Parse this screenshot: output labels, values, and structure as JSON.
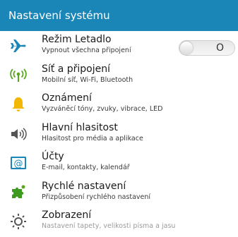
{
  "header": {
    "title": "Nastavení systému"
  },
  "items": [
    {
      "title": "Režim Letadlo",
      "subtitle": "Vypnout všechna připojení",
      "icon": "airplane-icon",
      "toggle": {
        "state": "O",
        "on": false
      }
    },
    {
      "title": "Síť a připojení",
      "subtitle": "Mobilní síť, Wi-Fi, Bluetooth",
      "icon": "antenna-icon"
    },
    {
      "title": "Oznámení",
      "subtitle": "Vyzváněcí tóny, zvuky, vibrace, LED",
      "icon": "bell-icon"
    },
    {
      "title": "Hlavní hlasitost",
      "subtitle": "Hlasitost pro média a aplikace",
      "icon": "speaker-icon"
    },
    {
      "title": "Účty",
      "subtitle": "E-mail, kontakty, kalendář",
      "icon": "at-sign-icon"
    },
    {
      "title": "Rychlé nastavení",
      "subtitle": "Přizpůsobení rychlého nastavení",
      "icon": "puzzle-icon"
    },
    {
      "title": "Zobrazení",
      "subtitle": "Nastavení tapety, velikosti písma a jasu",
      "icon": "sun-icon"
    }
  ],
  "colors": {
    "header_bg": "#1a86b8",
    "airplane": "#1a86b8",
    "antenna": "#5aa51f",
    "bell": "#f2b705",
    "speaker": "#555555",
    "accounts": "#1a86b8",
    "puzzle": "#3e9a1f"
  }
}
